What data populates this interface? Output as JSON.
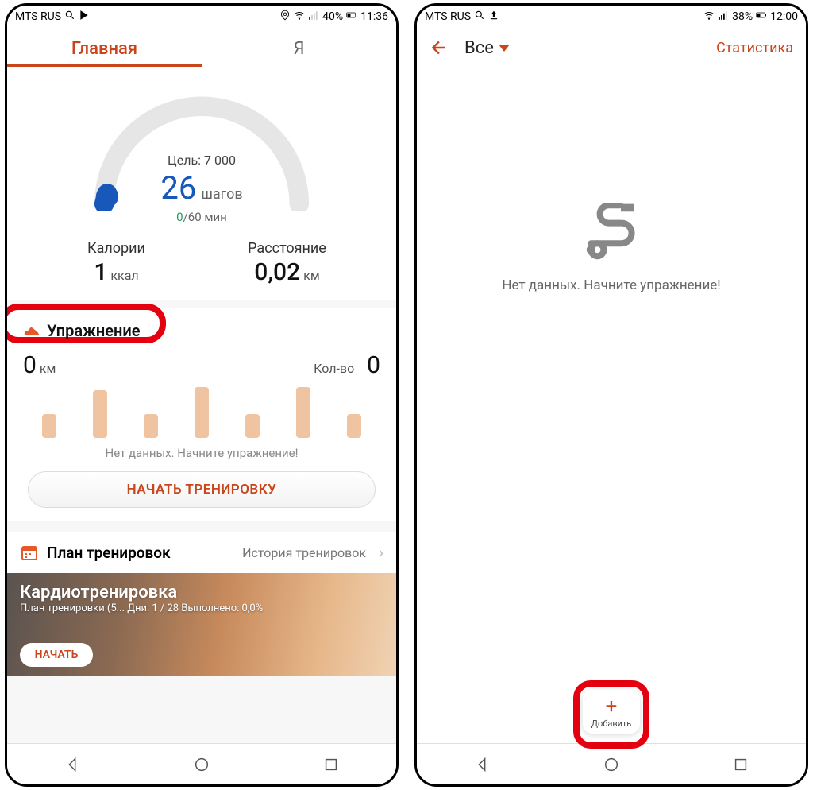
{
  "left": {
    "status": {
      "carrier": "MTS RUS",
      "battery": "40%",
      "time": "11:36"
    },
    "tabs": {
      "main": "Главная",
      "me": "Я"
    },
    "gauge": {
      "goal_label": "Цель: 7 000",
      "steps": "26",
      "steps_unit": "шагов",
      "mins_done": "0",
      "mins_total": "/60 мин"
    },
    "metrics": {
      "cal_label": "Калории",
      "cal_val": "1",
      "cal_unit": "ккал",
      "dist_label": "Расстояние",
      "dist_val": "0,02",
      "dist_unit": "км"
    },
    "exercise": {
      "title": "Упражнение",
      "km_val": "0",
      "km_unit": "км",
      "count_label": "Кол-во",
      "count_val": "0",
      "nodata": "Нет данных. Начните упражнение!",
      "start": "НАЧАТЬ ТРЕНИРОВКУ"
    },
    "plan": {
      "title": "План тренировок",
      "history": "История тренировок"
    },
    "cardio": {
      "title": "Кардиотренировка",
      "sub": "План тренировки (5...    Дни: 1 / 28    Выполнено: 0,0%",
      "btn": "НАЧАТЬ"
    }
  },
  "right": {
    "status": {
      "carrier": "MTS RUS",
      "battery": "38%",
      "time": "12:00"
    },
    "top": {
      "dropdown": "Все",
      "stats": "Статистика"
    },
    "empty": "Нет данных. Начните упражнение!",
    "fab": "Добавить"
  }
}
